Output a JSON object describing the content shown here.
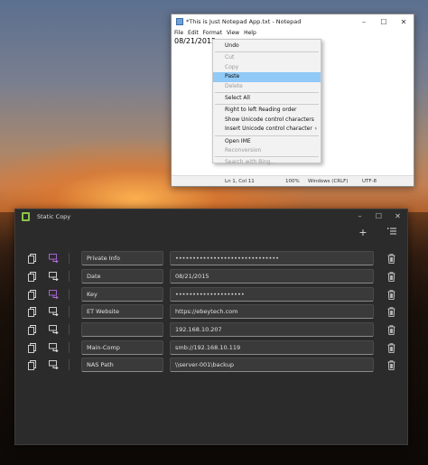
{
  "notepad": {
    "title": "*This is Just Notepad App.txt - Notepad",
    "menu": [
      "File",
      "Edit",
      "Format",
      "View",
      "Help"
    ],
    "content": "08/21/2015",
    "status": {
      "position": "Ln 1, Col 11",
      "zoom": "100%",
      "line_ending": "Windows (CRLF)",
      "encoding": "UTF-8"
    }
  },
  "context_menu": {
    "items": [
      {
        "label": "Undo",
        "state": "enabled"
      },
      {
        "sep": true
      },
      {
        "label": "Cut",
        "state": "disabled"
      },
      {
        "label": "Copy",
        "state": "disabled"
      },
      {
        "label": "Paste",
        "state": "highlighted"
      },
      {
        "label": "Delete",
        "state": "disabled"
      },
      {
        "sep": true
      },
      {
        "label": "Select All",
        "state": "enabled"
      },
      {
        "sep": true
      },
      {
        "label": "Right to left Reading order",
        "state": "enabled"
      },
      {
        "label": "Show Unicode control characters",
        "state": "enabled"
      },
      {
        "label": "Insert Unicode control character",
        "state": "enabled",
        "submenu": true
      },
      {
        "sep": true
      },
      {
        "label": "Open IME",
        "state": "enabled"
      },
      {
        "label": "Reconversion",
        "state": "disabled"
      },
      {
        "sep": true
      },
      {
        "label": "Search with Bing...",
        "state": "disabled"
      }
    ]
  },
  "static_copy": {
    "title": "Static Copy",
    "toolbar": {
      "add_icon": "plus-icon",
      "menu_icon": "list-menu-icon"
    },
    "rows": [
      {
        "label": "Private Info",
        "value": "••••••••••••••••••••••••••••••",
        "send_active": true
      },
      {
        "label": "Date",
        "value": "08/21/2015",
        "send_active": false
      },
      {
        "label": "Key",
        "value": "••••••••••••••••••••",
        "send_active": true
      },
      {
        "label": "ET Website",
        "value": "https://ebeytech.com",
        "send_active": false
      },
      {
        "label": "",
        "value": "192.168.10.207",
        "send_active": false
      },
      {
        "label": "Main-Comp",
        "value": "smb://192.168.10.119",
        "send_active": false
      },
      {
        "label": "NAS Path",
        "value": "\\\\server-001\\backup",
        "send_active": false
      }
    ],
    "colors": {
      "accent": "#b06ae0",
      "logo": "#8bc34a"
    }
  }
}
